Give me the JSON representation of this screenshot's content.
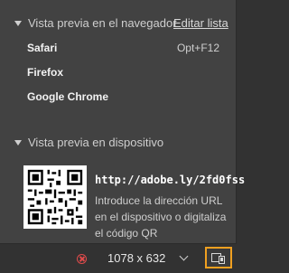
{
  "browser_section": {
    "title": "Vista previa en el navegador",
    "edit_link": "Editar lista",
    "items": [
      {
        "label": "Safari",
        "shortcut": "Opt+F12"
      },
      {
        "label": "Firefox"
      },
      {
        "label": "Google Chrome"
      }
    ]
  },
  "device_section": {
    "title": "Vista previa en dispositivo",
    "url": "http://adobe.ly/2fd0fss",
    "description": "Introduce la dirección URL en el dispositivo o digitaliza el código QR"
  },
  "bottom_bar": {
    "size_value": "1078 x 632"
  },
  "colors": {
    "accent": "#f0a020",
    "error": "#e04b4b"
  },
  "icons": {
    "stop": "stop-icon",
    "dropdown": "chevron-down-icon",
    "preview": "preview-device-icon"
  }
}
